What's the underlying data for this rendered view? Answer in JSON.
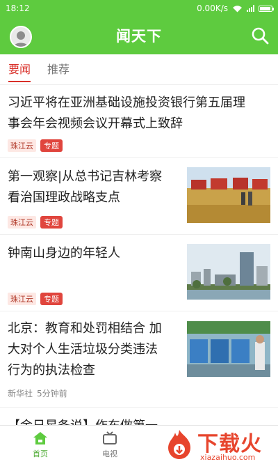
{
  "status_bar": {
    "time": "18:12",
    "network_speed": "0.00K/s"
  },
  "app_bar": {
    "title": "闻天下",
    "accent_color": "#5ecb3f"
  },
  "tabs": [
    {
      "label": "要闻",
      "active": true
    },
    {
      "label": "推荐",
      "active": false
    }
  ],
  "news": [
    {
      "headline_lines": [
        "习近平将在亚洲基础设施投资银行第五届理",
        "事会年会视频会议开幕式上致辞"
      ],
      "source": "珠江云",
      "tag": "专题"
    },
    {
      "headline_lines": [
        "第一观察|从总书记吉林考察",
        "看治国理政战略支点"
      ],
      "source": "珠江云",
      "tag": "专题",
      "thumb": "harvest-field-photo"
    },
    {
      "headline_lines": [
        "钟南山身边的年轻人"
      ],
      "source": "珠江云",
      "tag": "专题",
      "thumb": "city-skyline-photo"
    },
    {
      "headline_lines": [
        "北京：教育和处罚相结合 加",
        "大对个人生活垃圾分类违法",
        "行为的执法检查"
      ],
      "source": "新华社",
      "time": "5分钟前",
      "thumb": "garbage-sorting-photo"
    },
    {
      "headline_lines": [
        "【金日星条说】作东做第一"
      ]
    }
  ],
  "bottom_nav": [
    {
      "label": "首页",
      "icon": "home-icon",
      "active": true
    },
    {
      "label": "电视",
      "icon": "tv-icon",
      "active": false
    }
  ],
  "watermark": {
    "text": "下载火",
    "sub": "xiazaihuo.com"
  }
}
